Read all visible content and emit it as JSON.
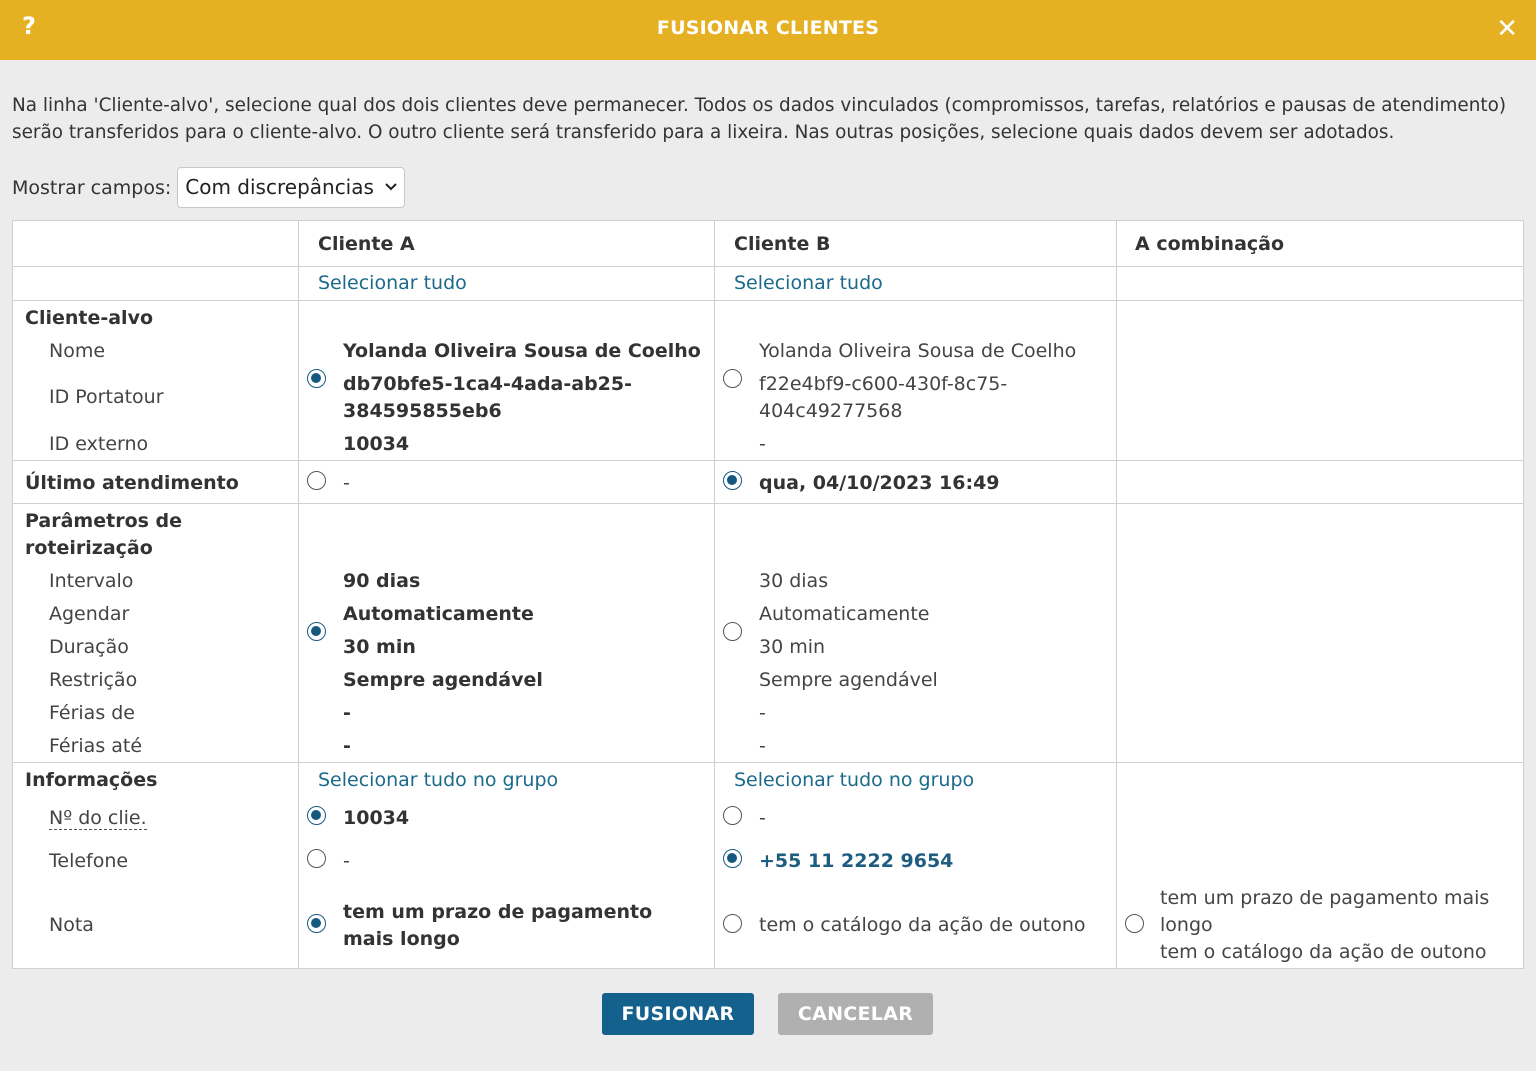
{
  "dialog": {
    "title": "FUSIONAR CLIENTES",
    "help_label": "?",
    "close_label": "✕",
    "accent_color": "#e5b021"
  },
  "intro": "Na linha 'Cliente-alvo', selecione qual dos dois clientes deve permanecer. Todos os dados vinculados (compromissos, tarefas, relatórios e pausas de atendimento) serão transferidos para o cliente-alvo. O outro cliente será transferido para a lixeira. Nas outras posições, selecione quais dados devem ser adotados.",
  "filter": {
    "label": "Mostrar campos:",
    "selected": "Com discrepâncias",
    "chevron": "⌄"
  },
  "columns": {
    "a": "Cliente A",
    "b": "Cliente B",
    "combo": "A combinação"
  },
  "select_all": "Selecionar tudo",
  "select_all_group": "Selecionar tudo no grupo",
  "target": {
    "group": "Cliente-alvo",
    "labels": {
      "name": "Nome",
      "portatour_id": "ID Portatour",
      "external_id": "ID externo"
    },
    "a": {
      "name": "Yolanda Oliveira Sousa de Coelho",
      "portatour_id_1": "db70bfe5-1ca4-4ada-ab25-",
      "portatour_id_2": "384595855eb6",
      "external_id": "10034"
    },
    "b": {
      "name": "Yolanda Oliveira Sousa de Coelho",
      "portatour_id_1": "f22e4bf9-c600-430f-8c75-",
      "portatour_id_2": "404c49277568",
      "external_id": "-"
    },
    "selected": "a"
  },
  "last_service": {
    "group": "Último atendimento",
    "a": "-",
    "b": "qua, 04/10/2023 16:49",
    "selected": "b"
  },
  "routing": {
    "group_1": "Parâmetros de",
    "group_2": "roteirização",
    "labels": {
      "interval": "Intervalo",
      "schedule": "Agendar",
      "duration": "Duração",
      "restriction": "Restrição",
      "vacation_from": "Férias de",
      "vacation_to": "Férias até"
    },
    "a": {
      "interval": "90 dias",
      "schedule": "Automaticamente",
      "duration": "30 min",
      "restriction": "Sempre agendável",
      "vacation_from": "-",
      "vacation_to": "-"
    },
    "b": {
      "interval": "30 dias",
      "schedule": "Automaticamente",
      "duration": "30 min",
      "restriction": "Sempre agendável",
      "vacation_from": "-",
      "vacation_to": "-"
    },
    "selected": "a"
  },
  "info": {
    "group": "Informações",
    "labels": {
      "client_no": "Nº do clie.",
      "phone": "Telefone",
      "note": "Nota"
    },
    "client_no": {
      "a": "10034",
      "b": "-",
      "selected": "a"
    },
    "phone": {
      "a": "-",
      "b": "+55 11 2222 9654",
      "selected": "b"
    },
    "note": {
      "a": "tem um prazo de pagamento mais longo",
      "b": "tem o catálogo da ação de outono",
      "combo_1": "tem um prazo de pagamento mais longo",
      "combo_2": "tem o catálogo da ação de outono",
      "selected": "a"
    }
  },
  "buttons": {
    "merge": "FUSIONAR",
    "cancel": "CANCELAR"
  }
}
